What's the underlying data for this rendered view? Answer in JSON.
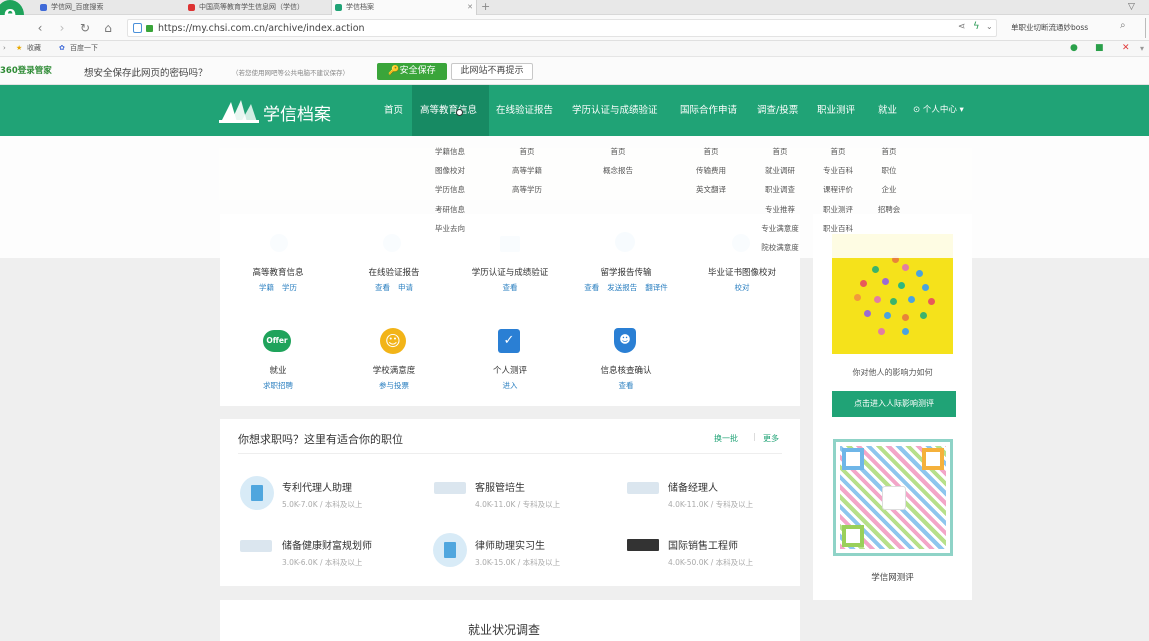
{
  "browser": {
    "tabs": [
      {
        "title": "学信网_百度搜索"
      },
      {
        "title": "中国高等教育学生信息网（学信）"
      },
      {
        "title": "学信档案"
      }
    ],
    "url": "https://my.chsi.com.cn/archive/index.action",
    "search_text": "单职业切断流通妙boss",
    "bookmarks": [
      "收藏",
      "百度一下"
    ]
  },
  "password_bar": {
    "brand": "360登录管家",
    "question": "想安全保存此网页的密码吗？",
    "note": "（若您使用网吧等公共电脑不建议保存）",
    "save_button": "安全保存",
    "never_button": "此网站不再提示"
  },
  "site": {
    "logo_text": "学信档案",
    "nav": [
      "首页",
      "高等教育信息",
      "在线验证报告",
      "学历认证与成绩验证",
      "国际合作申请",
      "调查/投票",
      "职业测评",
      "就业"
    ],
    "user_center": "个人中心",
    "dropdown": [
      [
        "学籍信息",
        "图像校对",
        "学历信息",
        "考研信息",
        "毕业去向"
      ],
      [
        "首页",
        "高等学籍",
        "高等学历"
      ],
      [
        "首页",
        "概念报告"
      ],
      [
        "首页",
        "传输费用",
        "英文翻译"
      ],
      [
        "首页",
        "就业调研",
        "职业调查",
        "专业推荐",
        "专业满意度",
        "院校满意度"
      ],
      [
        "首页",
        "专业百科",
        "课程评价",
        "职业测评",
        "职业百科"
      ],
      [
        "首页",
        "职位",
        "企业",
        "招聘会"
      ]
    ],
    "services_row1": [
      {
        "name": "高等教育信息",
        "links": [
          "学籍",
          "学历"
        ]
      },
      {
        "name": "在线验证报告",
        "links": [
          "查看",
          "申请"
        ]
      },
      {
        "name": "学历认证与成绩验证",
        "links": [
          "查看"
        ]
      },
      {
        "name": "留学报告传输",
        "links": [
          "查看",
          "发送报告",
          "翻译件"
        ]
      },
      {
        "name": "毕业证书图像校对",
        "links": [
          "校对"
        ]
      }
    ],
    "services_row2": [
      {
        "name": "就业",
        "links": [
          "求职招聘"
        ],
        "icon_text": "Offer"
      },
      {
        "name": "学校满意度",
        "links": [
          "参与投票"
        ]
      },
      {
        "name": "个人测评",
        "links": [
          "进入"
        ]
      },
      {
        "name": "信息核查确认",
        "links": [
          "查看"
        ]
      }
    ],
    "jobs_section": {
      "title": "你想求职吗？这里有适合你的职位",
      "refresh": "换一批",
      "more": "更多",
      "jobs": [
        {
          "title": "专利代理人助理",
          "meta": "5.0K-7.0K / 本科及以上"
        },
        {
          "title": "客服管培生",
          "meta": "4.0K-11.0K / 专科及以上"
        },
        {
          "title": "储备经理人",
          "meta": "4.0K-11.0K / 专科及以上"
        },
        {
          "title": "储备健康财富规划师",
          "meta": "3.0K-6.0K / 本科及以上"
        },
        {
          "title": "律师助理实习生",
          "meta": "3.0K-15.0K / 本科及以上"
        },
        {
          "title": "国际销售工程师",
          "meta": "4.0K-50.0K / 本科及以上"
        }
      ]
    },
    "sidebar": {
      "caption": "你对他人的影响力如何",
      "button": "点击进入人际影响测评",
      "qr_caption": "学信网测评"
    },
    "survey_title": "就业状况调查"
  },
  "colors": {
    "brand_green": "#20a376",
    "link_blue": "#2a7fc0",
    "save_green": "#3aa53a",
    "promo_yellow": "#f5e21b"
  }
}
